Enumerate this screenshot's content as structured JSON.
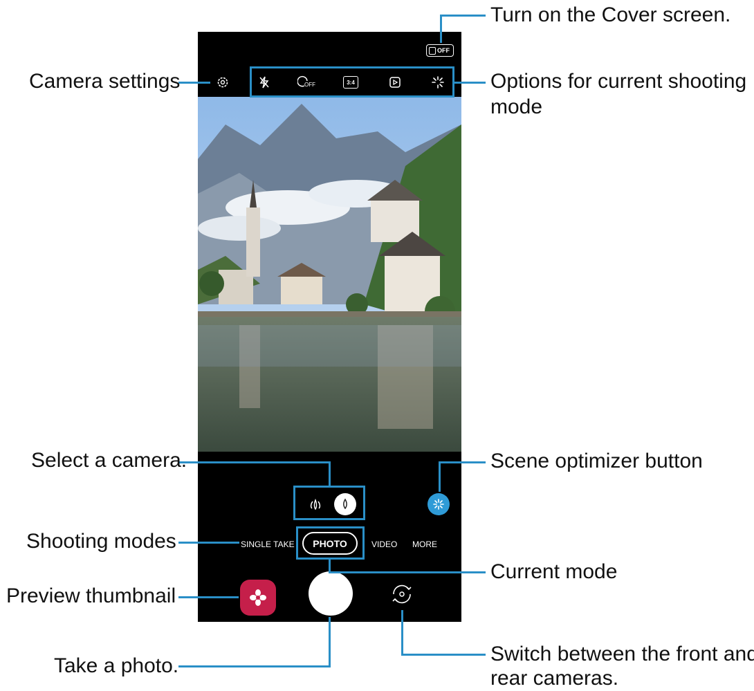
{
  "labels": {
    "cover_screen": "Turn on the Cover screen.",
    "options_line1": "Options for current shooting",
    "options_line2": "mode",
    "camera_settings": "Camera settings",
    "select_camera": "Select a camera.",
    "scene_optimizer": "Scene optimizer button",
    "shooting_modes": "Shooting modes",
    "current_mode": "Current mode",
    "preview_thumbnail": "Preview thumbnail",
    "take_photo": "Take a photo.",
    "switch_line1": "Switch between the front and",
    "switch_line2": "rear cameras."
  },
  "phone": {
    "cover_toggle_text": "OFF",
    "timer_text": "OFF",
    "ratio_text": "3:4",
    "modes": [
      "SINGLE TAKE",
      "PHOTO",
      "VIDEO",
      "MORE"
    ],
    "selected_mode": "PHOTO",
    "icons": [
      "gear-icon",
      "flash-off-icon",
      "timer-off-icon",
      "ratio-icon",
      "motion-photo-icon",
      "filter-icon",
      "wide-lens-icon",
      "standard-lens-icon",
      "scene-optimizer-icon",
      "gallery-thumbnail-icon",
      "shutter-icon",
      "switch-camera-icon"
    ]
  },
  "colors": {
    "accent": "#2a8fc7",
    "thumbnail": "#c51f4a",
    "scene_optimizer": "#2f9bd7"
  }
}
